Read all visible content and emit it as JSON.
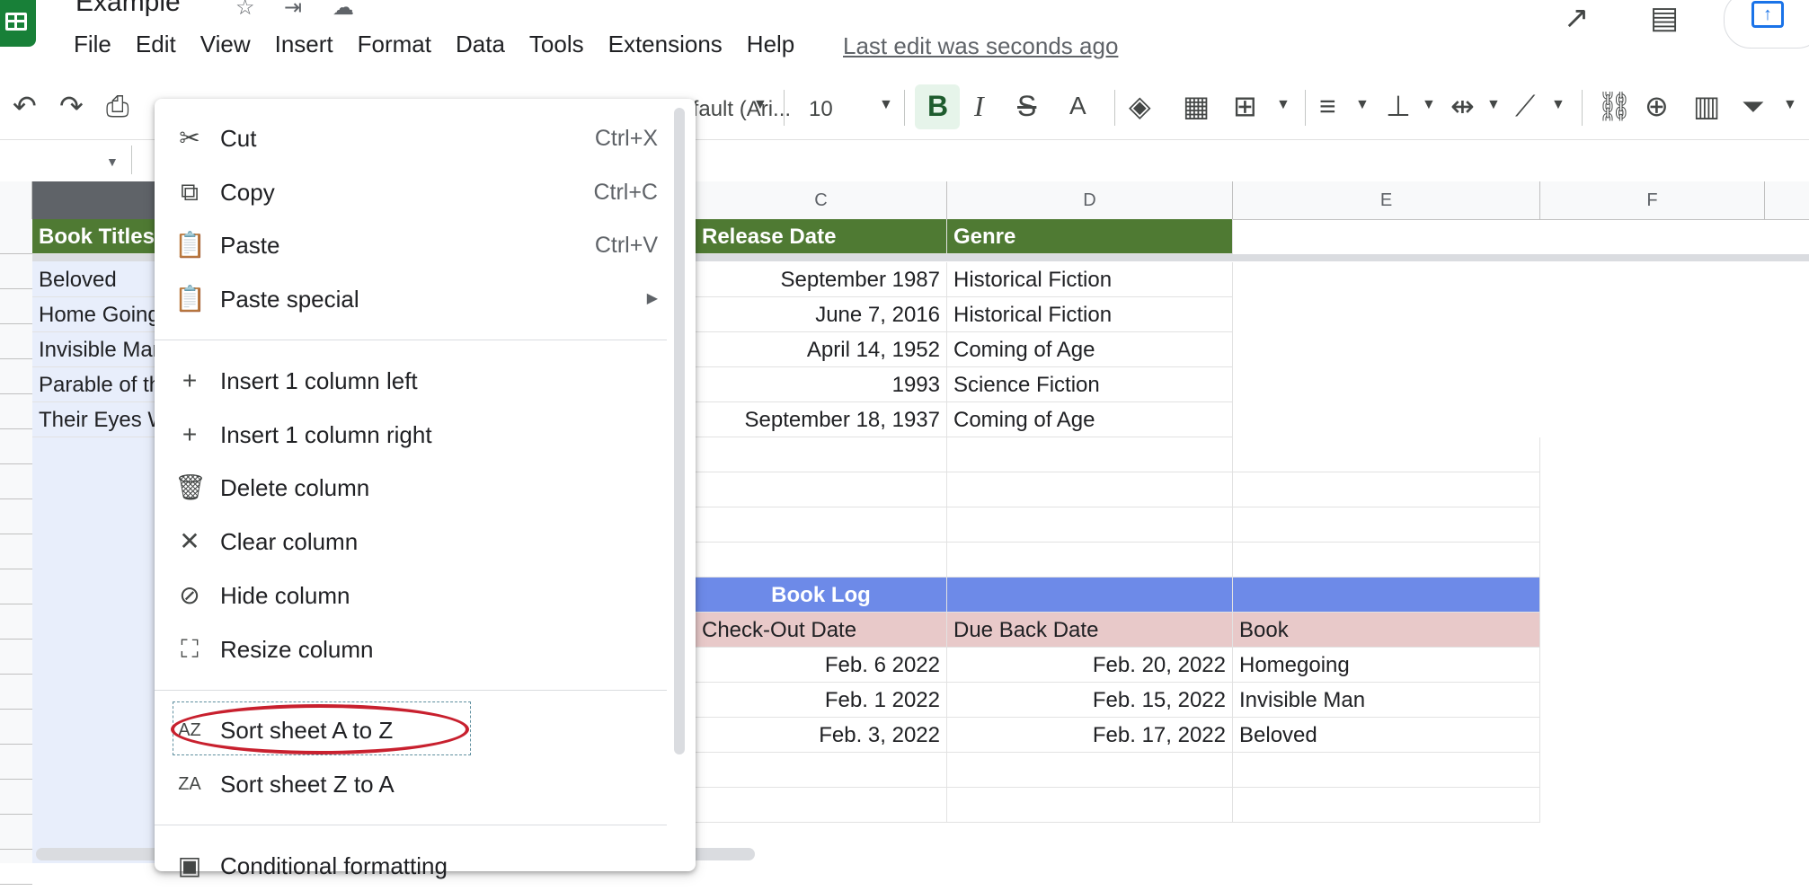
{
  "header": {
    "title": "Example",
    "menu": [
      "File",
      "Edit",
      "View",
      "Insert",
      "Format",
      "Data",
      "Tools",
      "Extensions",
      "Help"
    ],
    "last_edit": "Last edit was seconds ago"
  },
  "toolbar": {
    "font_name": "Default (Ari...",
    "font_size": "10",
    "bold_label": "B"
  },
  "columns": {
    "c": "C",
    "d": "D",
    "e": "E",
    "f": "F"
  },
  "sheet": {
    "header_row": {
      "b": "Book Titles",
      "c": "Release Date",
      "d": "Genre"
    },
    "rows": [
      {
        "b": "Beloved",
        "c": "September 1987",
        "d": "Historical Fiction"
      },
      {
        "b": "Home Going",
        "c": "June 7, 2016",
        "d": "Historical Fiction"
      },
      {
        "b": "Invisible Man",
        "c": "April 14, 1952",
        "d": "Coming of Age"
      },
      {
        "b": "Parable of the",
        "c": "1993",
        "d": "Science Fiction"
      },
      {
        "b": "Their Eyes W",
        "c": "September 18, 1937",
        "d": "Coming of Age"
      }
    ],
    "log_title": "Book Log",
    "log_headers": {
      "c": "Check-Out Date",
      "d": "Due Back Date",
      "e": "Book"
    },
    "log_rows": [
      {
        "c": "Feb. 6 2022",
        "d": "Feb. 20, 2022",
        "e": "Homegoing"
      },
      {
        "c": "Feb. 1 2022",
        "d": "Feb. 15, 2022",
        "e": "Invisible Man"
      },
      {
        "c": "Feb. 3, 2022",
        "d": "Feb. 17, 2022",
        "e": "Beloved"
      }
    ]
  },
  "context_menu": {
    "cut": {
      "label": "Cut",
      "shortcut": "Ctrl+X"
    },
    "copy": {
      "label": "Copy",
      "shortcut": "Ctrl+C"
    },
    "paste": {
      "label": "Paste",
      "shortcut": "Ctrl+V"
    },
    "paste_special": {
      "label": "Paste special"
    },
    "insert_left": {
      "label": "Insert 1 column left"
    },
    "insert_right": {
      "label": "Insert 1 column right"
    },
    "delete": {
      "label": "Delete column"
    },
    "clear": {
      "label": "Clear column"
    },
    "hide": {
      "label": "Hide column"
    },
    "resize": {
      "label": "Resize column"
    },
    "sort_az": {
      "label": "Sort sheet A to Z"
    },
    "sort_za": {
      "label": "Sort sheet Z to A"
    },
    "conditional": {
      "label": "Conditional formatting"
    }
  },
  "colors": {
    "green_header": "#4f7a33",
    "blue_header": "#6d8ae8",
    "pink_header": "#e8c9c9",
    "highlight_ellipse": "#c8202e"
  }
}
